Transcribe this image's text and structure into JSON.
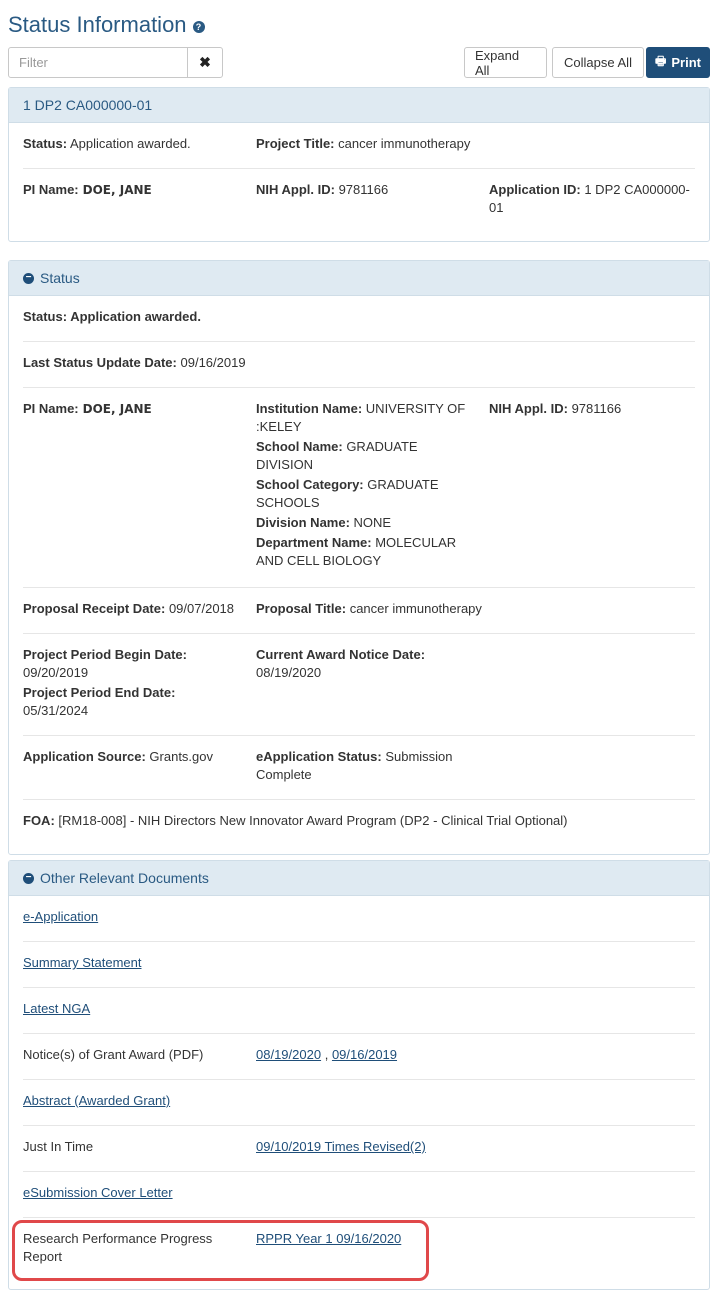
{
  "page": {
    "title": "Status Information",
    "help_icon": "question-circle-icon"
  },
  "toolbar": {
    "filter_placeholder": "Filter",
    "clear_icon": "close-icon",
    "expand_all": "Expand All",
    "collapse_all": "Collapse All",
    "print": "Print",
    "print_icon": "printer-icon"
  },
  "summary": {
    "header": "1 DP2 CA000000-01",
    "status_label": "Status:",
    "status_value": "Application awarded.",
    "project_title_label": "Project Title:",
    "project_title_value": "cancer immunotherapy",
    "pi_label": "PI Name:",
    "pi_value": "DOE, JANE",
    "appl_id_label": "NIH Appl. ID:",
    "appl_id_value": "9781166",
    "application_id_label": "Application ID:",
    "application_id_value": "1 DP2 CA000000-01"
  },
  "status": {
    "header": "Status",
    "status_text": "Status: Application awarded.",
    "last_update_label": "Last Status Update Date:",
    "last_update_value": "09/16/2019",
    "pi_label": "PI Name:",
    "pi_value": "DOE, JANE",
    "institution_label": "Institution Name:",
    "institution_value": "UNIVERSITY OF :KELEY",
    "school_label": "School Name:",
    "school_value": "GRADUATE DIVISION",
    "school_category_label": "School Category:",
    "school_category_value": "GRADUATE SCHOOLS",
    "division_label": "Division Name:",
    "division_value": "NONE",
    "department_label": "Department Name:",
    "department_value": "MOLECULAR AND CELL BIOLOGY",
    "appl_id_label": "NIH Appl. ID:",
    "appl_id_value": "9781166",
    "receipt_label": "Proposal Receipt Date:",
    "receipt_value": "09/07/2018",
    "proposal_title_label": "Proposal Title:",
    "proposal_title_value": "cancer immunotherapy",
    "begin_label": "Project Period Begin Date:",
    "begin_value": "09/20/2019",
    "end_label": "Project Period End Date:",
    "end_value": "05/31/2024",
    "award_notice_label": "Current Award Notice Date:",
    "award_notice_value": "08/19/2020",
    "source_label": "Application Source:",
    "source_value": "Grants.gov",
    "eapp_status_label": "eApplication Status:",
    "eapp_status_value": "Submission Complete",
    "foa_label": "FOA:",
    "foa_value": "[RM18-008] -  NIH Directors New Innovator Award Program (DP2 - Clinical Trial Optional)"
  },
  "documents": {
    "header": "Other Relevant Documents",
    "e_application": "e-Application",
    "summary_statement": "Summary Statement",
    "latest_nga": "Latest NGA",
    "noga_label": "Notice(s) of Grant Award (PDF)",
    "noga_link_1": "08/19/2020",
    "noga_sep": ",",
    "noga_link_2": "09/16/2019",
    "abstract": "Abstract (Awarded Grant)",
    "jit_label": "Just In Time",
    "jit_link": "09/10/2019 Times Revised(2)",
    "cover_letter": "eSubmission Cover Letter",
    "rppr_label": "Research Performance Progress Report",
    "rppr_link": "RPPR Year 1 09/16/2020"
  },
  "colors": {
    "accent": "#1f4e79",
    "panel_header": "#dfeaf2",
    "highlight": "#e0484a"
  }
}
